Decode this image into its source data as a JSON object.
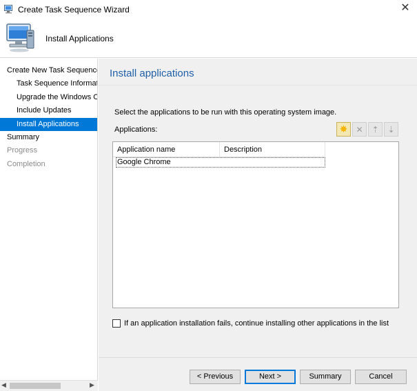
{
  "window": {
    "title": "Create Task Sequence Wizard",
    "close_glyph": "✕"
  },
  "header": {
    "title": "Install Applications"
  },
  "sidebar": {
    "items": [
      {
        "label": "Create New Task Sequence",
        "state": "normal"
      },
      {
        "label": "Task Sequence Information",
        "state": "normal"
      },
      {
        "label": "Upgrade the Windows Operating System",
        "state": "normal"
      },
      {
        "label": "Include Updates",
        "state": "normal"
      },
      {
        "label": "Install Applications",
        "state": "active"
      },
      {
        "label": "Summary",
        "state": "normal"
      },
      {
        "label": "Progress",
        "state": "disabled"
      },
      {
        "label": "Completion",
        "state": "disabled"
      }
    ],
    "scroll_left": "◀",
    "scroll_right": "▶"
  },
  "main": {
    "page_title": "Install applications",
    "instruction": "Select the applications to be run with this operating system image.",
    "applications_label": "Applications:",
    "toolbar": {
      "new_icon": "✸",
      "delete_icon": "✕",
      "move_up_icon": "⇡",
      "move_down_icon": "⇣"
    },
    "table": {
      "columns": [
        "Application name",
        "Description"
      ],
      "rows": [
        {
          "name": "Google Chrome",
          "description": ""
        }
      ]
    },
    "continue_on_error": {
      "label": "If an application installation fails, continue installing other applications in the list",
      "checked": false
    }
  },
  "footer": {
    "previous": "< Previous",
    "next": "Next >",
    "summary": "Summary",
    "cancel": "Cancel"
  },
  "colors": {
    "accent": "#0078d7",
    "title_blue": "#1e5fa8",
    "new_icon": "#f5b400"
  }
}
